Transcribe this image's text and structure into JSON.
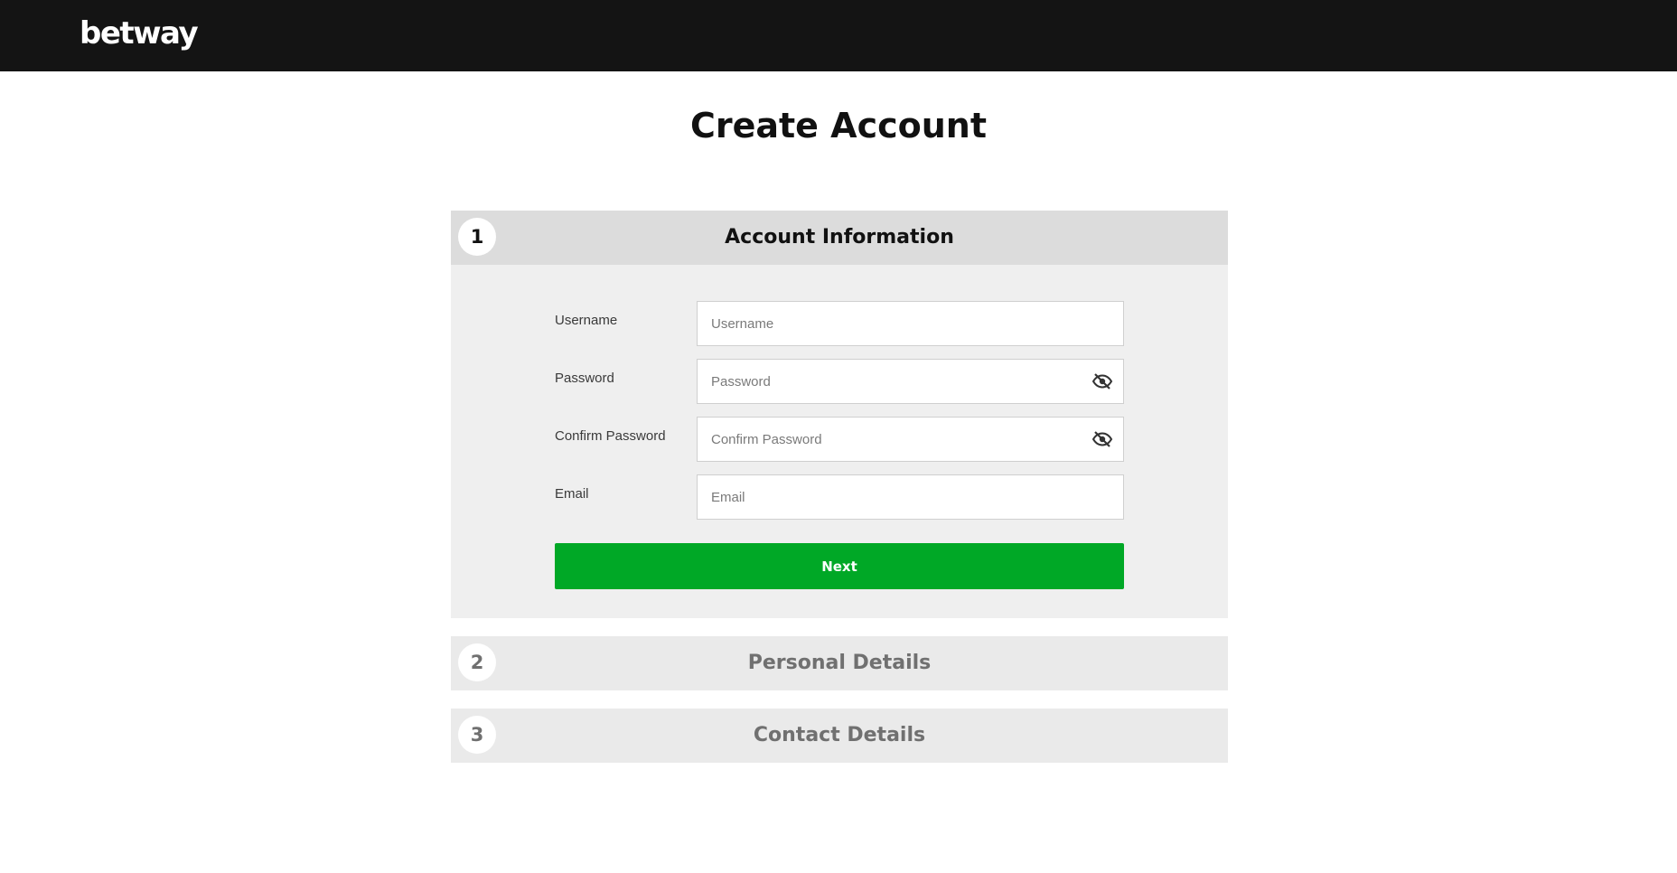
{
  "header": {
    "logo_text": "betway"
  },
  "page": {
    "title": "Create Account"
  },
  "steps": [
    {
      "number": "1",
      "title": "Account Information",
      "expanded": true
    },
    {
      "number": "2",
      "title": "Personal Details",
      "expanded": false
    },
    {
      "number": "3",
      "title": "Contact Details",
      "expanded": false
    }
  ],
  "form": {
    "username": {
      "label": "Username",
      "placeholder": "Username",
      "value": ""
    },
    "password": {
      "label": "Password",
      "placeholder": "Password",
      "value": "",
      "toggle_icon": "eye-slash-icon"
    },
    "confirm_password": {
      "label": "Confirm Password",
      "placeholder": "Confirm Password",
      "value": "",
      "toggle_icon": "eye-slash-icon"
    },
    "email": {
      "label": "Email",
      "placeholder": "Email",
      "value": ""
    },
    "next_label": "Next"
  },
  "colors": {
    "topbar": "#141414",
    "primary_button": "#00a826",
    "active_step_header": "#dcdcdc",
    "inactive_step_header": "#eaeaea",
    "panel_background": "#efefef"
  }
}
